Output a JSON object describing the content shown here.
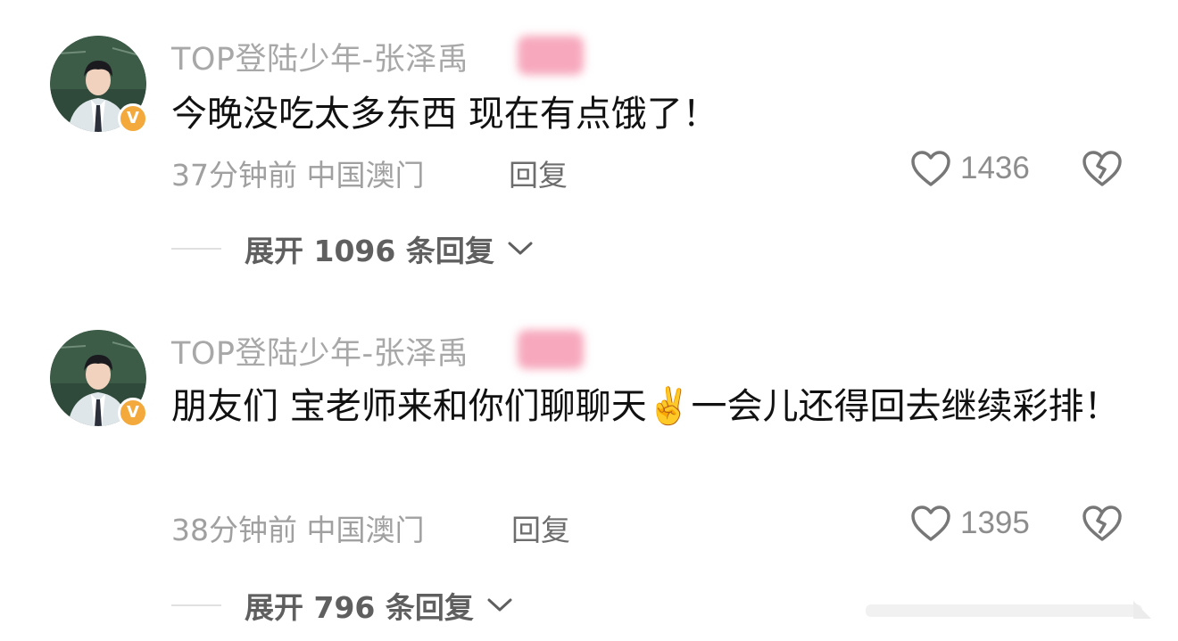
{
  "comments": [
    {
      "username": "TOP登陆少年-张泽禹",
      "text": "今晚没吃太多东西 现在有点饿了！",
      "time_location": "37分钟前 中国澳门",
      "reply_label": "回复",
      "likes": "1436",
      "expand_label": "展开 1096 条回复",
      "verified_badge": "V"
    },
    {
      "username": "TOP登陆少年-张泽禹",
      "text": "朋友们 宝老师来和你们聊聊天✌️一会儿还得回去继续彩排！",
      "time_location": "38分钟前 中国澳门",
      "reply_label": "回复",
      "likes": "1395",
      "expand_label": "展开 796 条回复",
      "verified_badge": "V"
    }
  ],
  "colors": {
    "username": "#a8a8a8",
    "body_text": "#111111",
    "meta": "#a0a0a0",
    "badge": "#f3a93b",
    "blurred_tag": "#f7a8bd"
  },
  "icons": [
    "heart-outline-icon",
    "broken-heart-icon",
    "chevron-down-icon",
    "verified-badge-icon"
  ]
}
